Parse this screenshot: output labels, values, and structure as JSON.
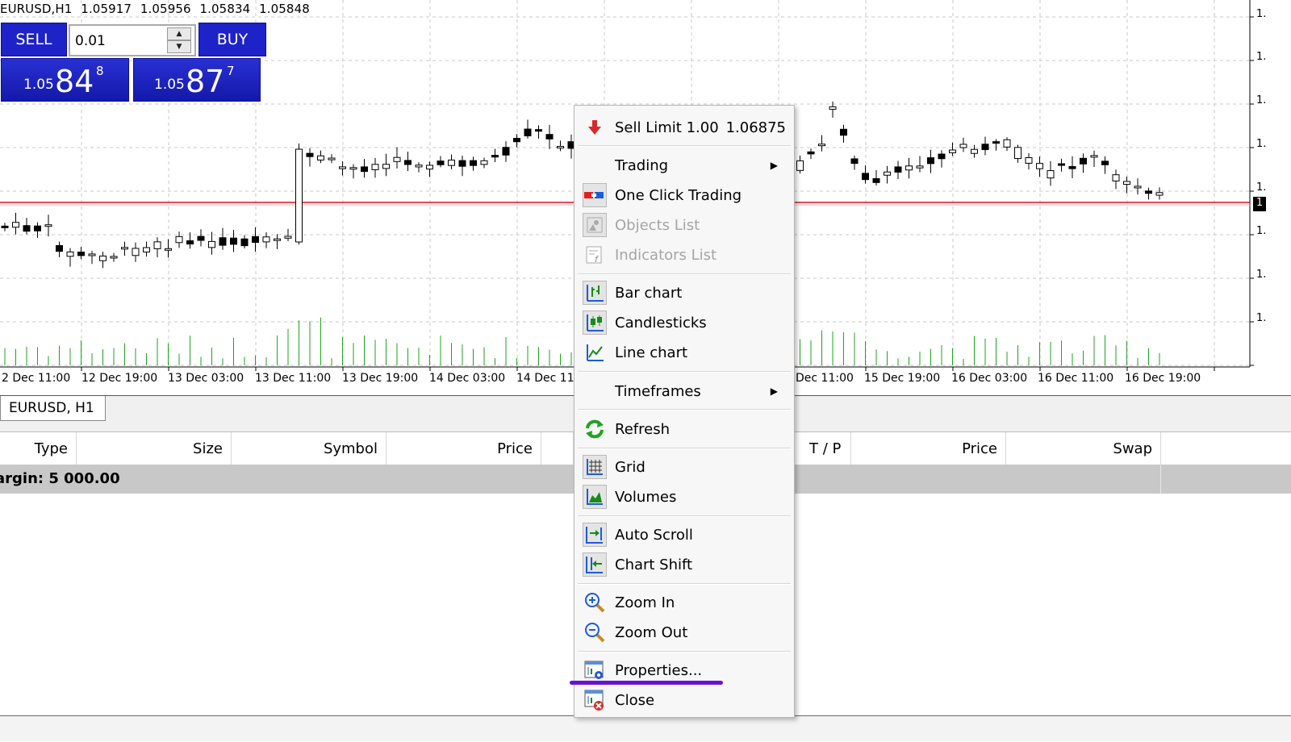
{
  "chart": {
    "symbol": "EURUSD,H1",
    "ohlc": [
      "1.05917",
      "1.05956",
      "1.05834",
      "1.05848"
    ],
    "time_labels": [
      "2 Dec 11:00",
      "12 Dec 19:00",
      "13 Dec 03:00",
      "13 Dec 11:00",
      "13 Dec 19:00",
      "14 Dec 03:00",
      "14 Dec 11:",
      "Dec 11:00",
      "15 Dec 19:00",
      "16 Dec 03:00",
      "16 Dec 11:00",
      "16 Dec 19:00"
    ],
    "price_axis_labels": [
      "1.",
      "1.",
      "1.",
      "1.",
      "1.",
      "1.",
      "1.",
      "1."
    ],
    "price_marker": "1",
    "colors": {
      "grid": "#c8c8c8",
      "bid_line": "#d8121b",
      "volume": "#1fa31f",
      "candle": "#000000"
    }
  },
  "one_click": {
    "sell_label": "SELL",
    "buy_label": "BUY",
    "lot_value": "0.01",
    "sell_price": {
      "prefix": "1.05",
      "big": "84",
      "sup": "8"
    },
    "buy_price": {
      "prefix": "1.05",
      "big": "87",
      "sup": "7"
    }
  },
  "tab": {
    "label": "EURUSD, H1"
  },
  "terminal": {
    "columns": [
      "Type",
      "Size",
      "Symbol",
      "Price",
      "T / P",
      "Price",
      "Swap"
    ],
    "balance_text": "argin: 5 000.00"
  },
  "context_menu": {
    "sell_limit": {
      "label": "Sell Limit 1.00",
      "value": "1.06875",
      "icon": "arrow-down-icon"
    },
    "items": {
      "trading": "Trading",
      "one_click_trading": "One Click Trading",
      "objects_list": "Objects List",
      "indicators_list": "Indicators List",
      "bar_chart": "Bar chart",
      "candlesticks": "Candlesticks",
      "line_chart": "Line chart",
      "timeframes": "Timeframes",
      "refresh": "Refresh",
      "grid": "Grid",
      "volumes": "Volumes",
      "auto_scroll": "Auto Scroll",
      "chart_shift": "Chart Shift",
      "zoom_in": "Zoom In",
      "zoom_out": "Zoom Out",
      "properties": "Properties...",
      "close": "Close"
    },
    "submenu_arrow": "▶",
    "highlight_color": "#6a11d6"
  }
}
